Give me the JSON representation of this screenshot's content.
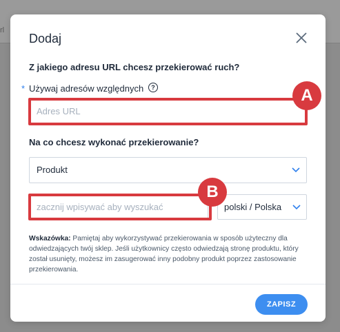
{
  "background": {
    "fragment_text": "rl"
  },
  "modal": {
    "title": "Dodaj",
    "question_source": "Z jakiego adresu URL chcesz przekierować ruch?",
    "required_mark": "*",
    "relative_label": "Używaj adresów względnych",
    "help_glyph": "?",
    "url_input": {
      "placeholder": "Adres URL",
      "value": ""
    },
    "question_target": "Na co chcesz wykonać przekierowanie?",
    "target_type": {
      "selected": "Produkt"
    },
    "search_input": {
      "placeholder": "zacznij wpisywać aby wyszukać",
      "value": ""
    },
    "language": {
      "selected": "polski / Polska"
    },
    "hint": {
      "label": "Wskazówka:",
      "text": "Pamiętaj aby wykorzystywać przekierowania w sposób użyteczny dla odwiedzających twój sklep. Jeśli użytkownicy często odwiedzają stronę produktu, który został usunięty, możesz im zasugerować inny podobny produkt poprzez zastosowanie przekierowania."
    },
    "save_label": "ZAPISZ"
  },
  "annotations": {
    "marker_a": "A",
    "marker_b": "B"
  },
  "colors": {
    "accent": "#3d8ef0",
    "highlight": "#d83a3f",
    "overlay": "#8c8c8c"
  },
  "icons": {
    "close": "close-icon",
    "help": "help-icon",
    "dropdown": "chevron-down-icon"
  }
}
